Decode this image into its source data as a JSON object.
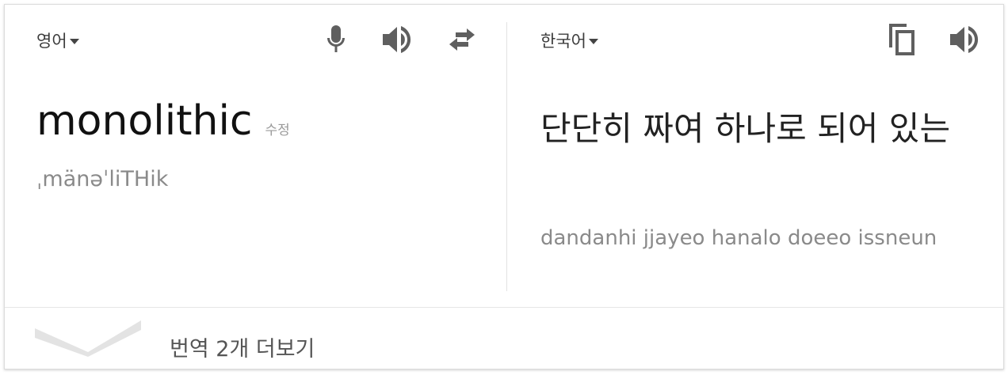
{
  "source": {
    "language": "영어",
    "text": "monolithic",
    "edit_label": "수정",
    "phonetic": "ˌmänəˈliTHik"
  },
  "target": {
    "language": "한국어",
    "text": "단단히 짜여 하나로 되어 있는",
    "romanization": "dandanhi jjayeo hanalo doeeo issneun"
  },
  "footer": {
    "more_translations": "번역 2개 더보기"
  },
  "icons": {
    "mic": "microphone-icon",
    "speaker": "speaker-icon",
    "swap": "swap-icon",
    "copy": "copy-icon",
    "chevron": "chevron-down-icon"
  },
  "colors": {
    "icon": "#5f5f5f",
    "muted_text": "#8a8a8a",
    "chevron": "#e3e3e3"
  }
}
